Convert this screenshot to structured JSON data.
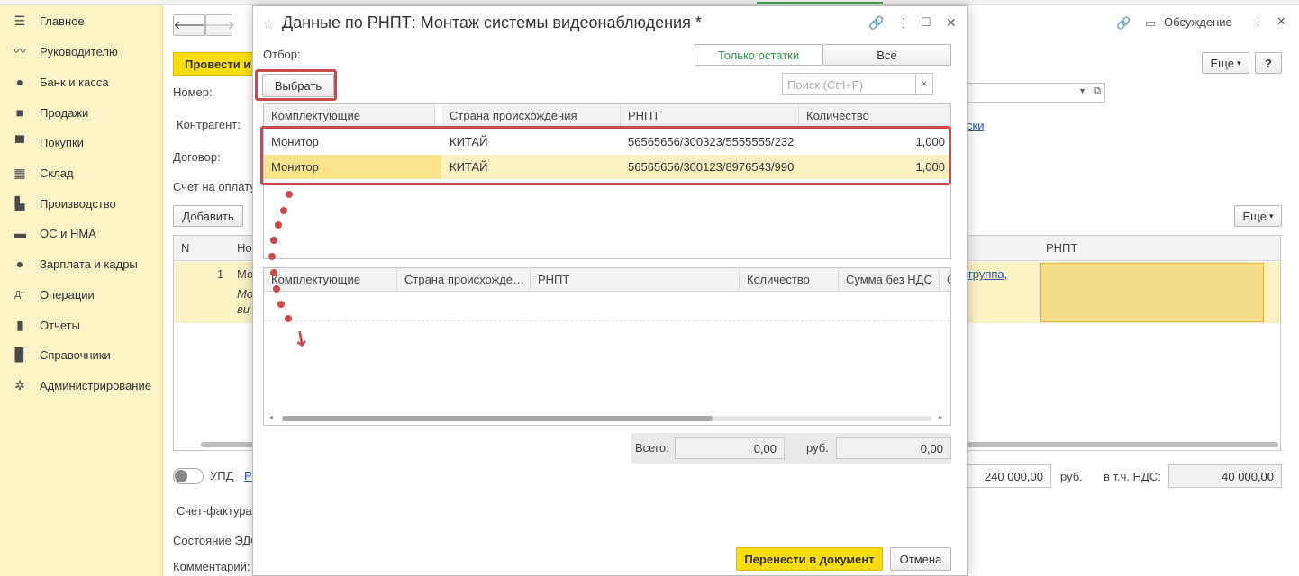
{
  "sidebar": {
    "items": [
      {
        "label": "Главное",
        "icon": "menu-icon"
      },
      {
        "label": "Руководителю",
        "icon": "trend-icon"
      },
      {
        "label": "Банк и касса",
        "icon": "coin-icon"
      },
      {
        "label": "Продажи",
        "icon": "bag-icon"
      },
      {
        "label": "Покупки",
        "icon": "cart-icon"
      },
      {
        "label": "Склад",
        "icon": "warehouse-icon"
      },
      {
        "label": "Производство",
        "icon": "factory-icon"
      },
      {
        "label": "ОС и НМА",
        "icon": "truck-icon"
      },
      {
        "label": "Зарплата и кадры",
        "icon": "person-icon"
      },
      {
        "label": "Операции",
        "icon": "operations-icon"
      },
      {
        "label": "Отчеты",
        "icon": "bar-chart-icon"
      },
      {
        "label": "Справочники",
        "icon": "book-icon"
      },
      {
        "label": "Администрирование",
        "icon": "gear-icon"
      }
    ]
  },
  "background": {
    "post_button": "Провести и",
    "labels": {
      "number": "Номер:",
      "counterparty": "Контрагент:",
      "contract": "Договор:",
      "invoice": "Счет на оплату",
      "upd": "УПД",
      "upd_link": "Р",
      "invoice_factura": "Счет-фактура",
      "edo_state": "Состояние ЭДО",
      "comment": "Комментарий:"
    },
    "add_button": "Добавить",
    "more_button": "Еще",
    "more_button2": "Еще",
    "help_button": "?",
    "discussion": "Обсуждение",
    "table": {
      "col_n": "N",
      "col_name": "Но",
      "col_rnpt": "РНПТ",
      "row_n": "1",
      "row_text1": "Мо",
      "row_text2": "Мо",
      "row_text3": "ви",
      "group_link": "группа,",
      "partial_link": "ски"
    },
    "totals": {
      "sum": "240 000,00",
      "currency": "руб.",
      "vat_label": "в т.ч. НДС:",
      "vat": "40 000,00"
    }
  },
  "dialog": {
    "title": "Данные по РНПТ: Монтаж системы видеонаблюдения *",
    "filter_label": "Отбор:",
    "filter_options": [
      "Только остатки",
      "Все"
    ],
    "select_button": "Выбрать",
    "search_placeholder": "Поиск (Ctrl+F)",
    "top_table": {
      "headers": [
        "Комплектующие",
        "Страна происхождения",
        "РНПТ",
        "Количество"
      ],
      "rows": [
        [
          "Монитор",
          "КИТАЙ",
          "56565656/300323/5555555/232",
          "1,000"
        ],
        [
          "Монитор",
          "КИТАЙ",
          "56565656/300123/8976543/990",
          "1,000"
        ]
      ]
    },
    "bottom_table": {
      "headers": [
        "Комплектующие",
        "Страна происхожде…",
        "РНПТ",
        "Количество",
        "Сумма без НДС",
        "С"
      ]
    },
    "totals": {
      "total_label": "Всего:",
      "total_value": "0,00",
      "currency": "руб.",
      "vat_value": "0,00"
    },
    "transfer_button": "Перенести в документ",
    "cancel_button": "Отмена"
  },
  "colors": {
    "accent_yellow": "#fbdc0f",
    "highlight_red": "#c94a4a",
    "selected_row": "#fde89a",
    "sidebar_bg": "#fbf3c6",
    "active_green": "#2e9a4a"
  }
}
